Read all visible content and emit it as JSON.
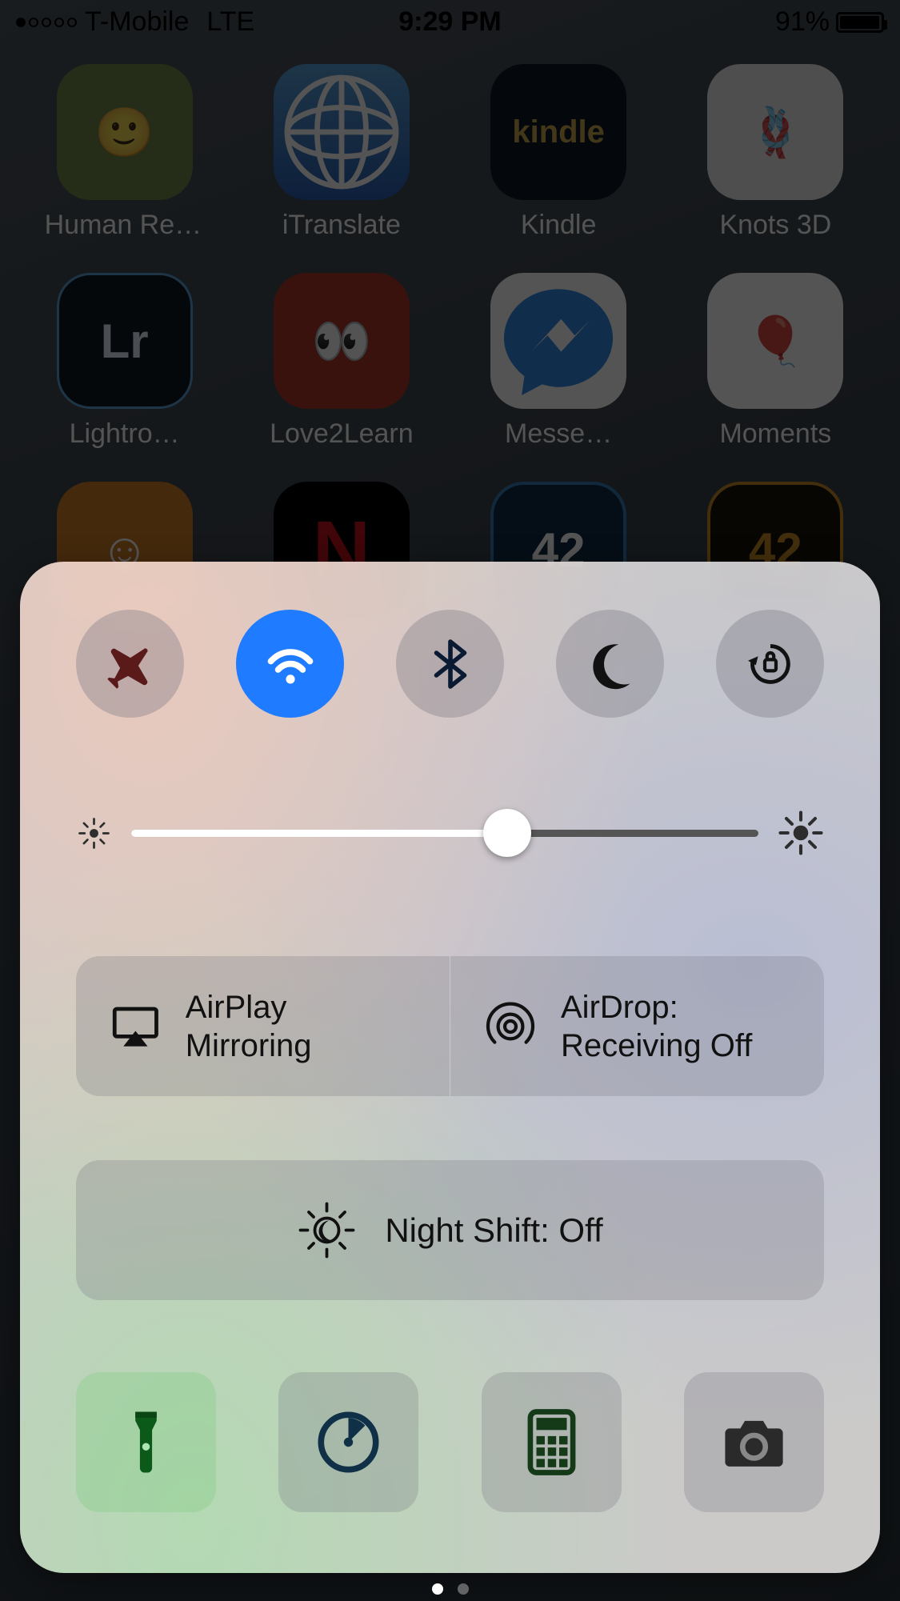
{
  "statusbar": {
    "carrier": "T-Mobile",
    "network": "LTE",
    "time": "9:29 PM",
    "battery_pct_label": "91%",
    "battery_pct": 91,
    "signal_filled": 1,
    "signal_total": 5
  },
  "apps": {
    "row1": [
      {
        "label": "Human Res…",
        "icon": "human-icon"
      },
      {
        "label": "iTranslate",
        "icon": "globe-icon"
      },
      {
        "label": "Kindle",
        "icon": "kindle-icon"
      },
      {
        "label": "Knots 3D",
        "icon": "knot-icon"
      }
    ],
    "row2": [
      {
        "label": "Lightro…",
        "icon": "lightroom-icon",
        "notif": true
      },
      {
        "label": "Love2Learn",
        "icon": "elmo-icon"
      },
      {
        "label": "Messe…",
        "icon": "messenger-icon",
        "notif": true
      },
      {
        "label": "Moments",
        "icon": "balloons-icon"
      }
    ],
    "row3": [
      {
        "label": "",
        "icon": "smiley-icon"
      },
      {
        "label": "",
        "icon": "netflix-icon"
      },
      {
        "label": "",
        "icon": "42-blue-icon"
      },
      {
        "label": "",
        "icon": "42-orange-icon"
      }
    ]
  },
  "control_center": {
    "toggles": {
      "airplane": {
        "active": false,
        "name": "airplane-mode-toggle"
      },
      "wifi": {
        "active": true,
        "name": "wifi-toggle"
      },
      "bluetooth": {
        "active": false,
        "name": "bluetooth-toggle"
      },
      "dnd": {
        "active": false,
        "name": "do-not-disturb-toggle"
      },
      "orientation_lock": {
        "active": false,
        "name": "orientation-lock-toggle"
      }
    },
    "brightness_pct": 60,
    "airplay_label": "AirPlay Mirroring",
    "airdrop_label_line1": "AirDrop:",
    "airdrop_label_line2": "Receiving Off",
    "nightshift_label": "Night Shift: Off",
    "shortcuts": [
      {
        "name": "flashlight-shortcut",
        "icon": "flashlight-icon"
      },
      {
        "name": "timer-shortcut",
        "icon": "timer-icon"
      },
      {
        "name": "calculator-shortcut",
        "icon": "calc-icon"
      },
      {
        "name": "camera-shortcut",
        "icon": "camera-icon"
      }
    ],
    "page_dots": {
      "total": 2,
      "active": 0
    }
  },
  "colors": {
    "accent_blue": "#1f7bff"
  }
}
